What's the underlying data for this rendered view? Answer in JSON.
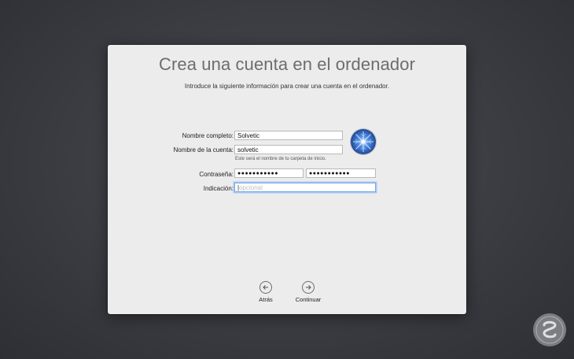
{
  "window": {
    "title": "Crea una cuenta en el ordenador",
    "subtitle": "Introduce la siguiente información para crear una cuenta en el ordenador."
  },
  "form": {
    "full_name": {
      "label": "Nombre completo:",
      "value": "Solvetic"
    },
    "account_name": {
      "label": "Nombre de la cuenta:",
      "value": "solvetic",
      "help": "Este será el nombre de tu carpeta de inicio."
    },
    "password": {
      "label": "Contraseña:",
      "value": "●●●●●●●●●●●",
      "verify_value": "●●●●●●●●●●●"
    },
    "hint": {
      "label": "Indicación:",
      "placeholder": "opcional",
      "value": ""
    }
  },
  "nav": {
    "back_label": "Atrás",
    "continue_label": "Continuar"
  },
  "colors": {
    "background": "#3b3c42",
    "window": "#ececec",
    "focus_ring": "#7aa7e8",
    "avatar_blue": "#1e4fb0"
  },
  "icons": {
    "avatar": "blue-snowflake-avatar",
    "back": "arrow-left-circle-icon",
    "continue": "arrow-right-circle-icon",
    "watermark": "solvetic-logo-watermark"
  }
}
